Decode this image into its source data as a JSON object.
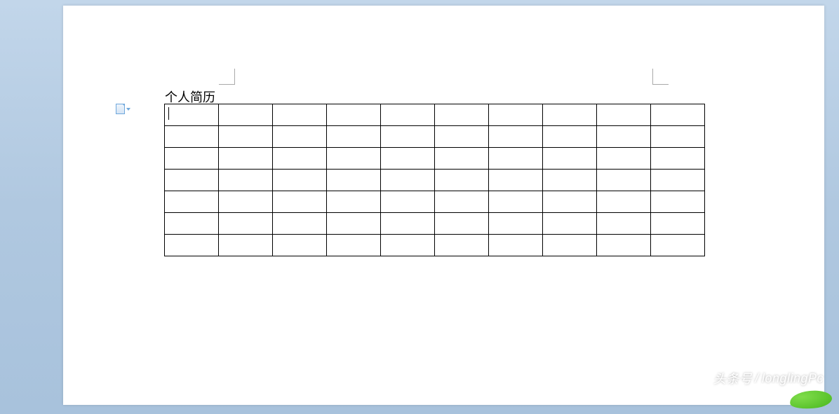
{
  "document": {
    "title": "个人简历",
    "table": {
      "rows": 7,
      "cols": 10,
      "cells": [
        [
          "",
          "",
          "",
          "",
          "",
          "",
          "",
          "",
          "",
          ""
        ],
        [
          "",
          "",
          "",
          "",
          "",
          "",
          "",
          "",
          "",
          ""
        ],
        [
          "",
          "",
          "",
          "",
          "",
          "",
          "",
          "",
          "",
          ""
        ],
        [
          "",
          "",
          "",
          "",
          "",
          "",
          "",
          "",
          "",
          ""
        ],
        [
          "",
          "",
          "",
          "",
          "",
          "",
          "",
          "",
          "",
          ""
        ],
        [
          "",
          "",
          "",
          "",
          "",
          "",
          "",
          "",
          "",
          ""
        ],
        [
          "",
          "",
          "",
          "",
          "",
          "",
          "",
          "",
          "",
          ""
        ]
      ]
    }
  },
  "smart_tag": {
    "name": "paste-options"
  },
  "watermark": {
    "source": "头条号",
    "separator": "/",
    "author": "longlingPc"
  }
}
